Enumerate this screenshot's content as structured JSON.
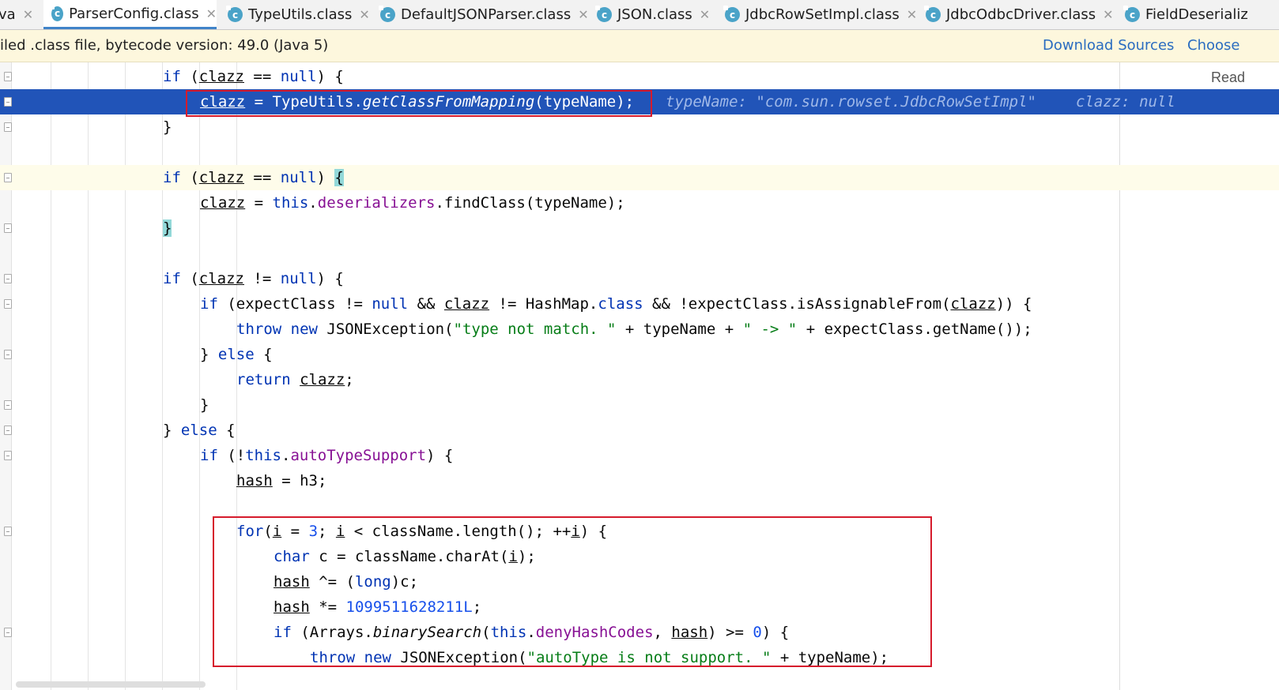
{
  "tabs": [
    {
      "label": "va",
      "partial": true
    },
    {
      "label": "ParserConfig.class",
      "active": true
    },
    {
      "label": "TypeUtils.class"
    },
    {
      "label": "DefaultJSONParser.class"
    },
    {
      "label": "JSON.class"
    },
    {
      "label": "JdbcRowSetImpl.class"
    },
    {
      "label": "JdbcOdbcDriver.class"
    },
    {
      "label": "FieldDeserializ"
    }
  ],
  "tab_icon_letter": "c",
  "tab_close_glyph": "✕",
  "banner": {
    "message": "iled .class file, bytecode version: 49.0 (Java 5)",
    "download_sources": "Download Sources",
    "choose": "Choose"
  },
  "editor": {
    "reader_mode_label": "Read",
    "inline_hints": {
      "typeName": "typeName: \"com.sun.rowset.JdbcRowSetImpl\"",
      "clazz": "clazz: null"
    },
    "colors": {
      "execution_line": "#2154b8",
      "keyword": "#0033b3",
      "field": "#871094",
      "string": "#067d17",
      "number": "#1750eb",
      "highlight_box": "#d61b2c"
    }
  }
}
